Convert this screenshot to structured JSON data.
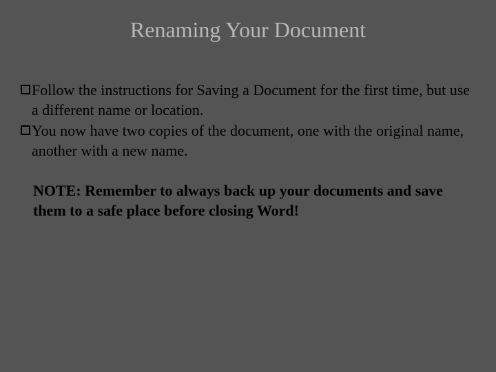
{
  "title": "Renaming Your Document",
  "bullets": [
    "Follow the instructions for Saving a Document for the first time, but use a different name or location.",
    "You now have two copies of the document, one with the original name, another with a new name."
  ],
  "note": "NOTE: Remember to always back up your documents and save them to a safe place before closing Word!"
}
